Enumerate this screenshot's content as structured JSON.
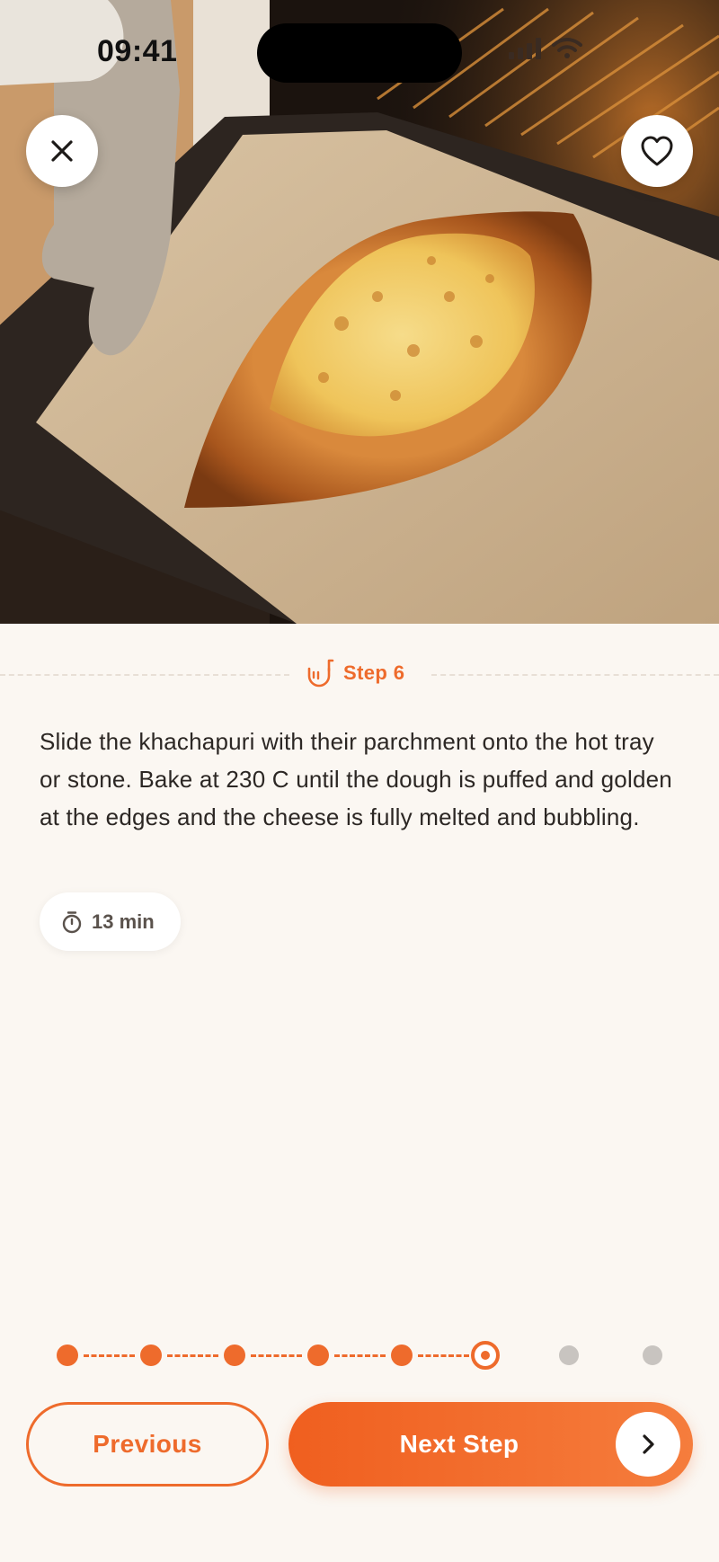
{
  "status_bar": {
    "time": "09:41"
  },
  "hero": {
    "image_alt": "Khachapuri on parchment being placed into oven"
  },
  "step": {
    "label": "Step 6"
  },
  "instruction": "Slide the khachapuri with their parchment onto the hot tray or stone. Bake at 230 C until the dough is puffed and golden at the edges and the cheese is fully melted and bubbling.",
  "timer": {
    "label": "13 min"
  },
  "progress": {
    "total_steps": 8,
    "current_step": 6
  },
  "buttons": {
    "previous": "Previous",
    "next": "Next Step"
  },
  "colors": {
    "accent": "#EE6B2C",
    "background": "#FBF7F2",
    "inactive_dot": "#C8C4C0"
  },
  "icons": {
    "close": "close-icon",
    "favorite": "heart-icon",
    "step": "ladle-icon",
    "timer": "stopwatch-icon",
    "next": "chevron-right-icon"
  }
}
